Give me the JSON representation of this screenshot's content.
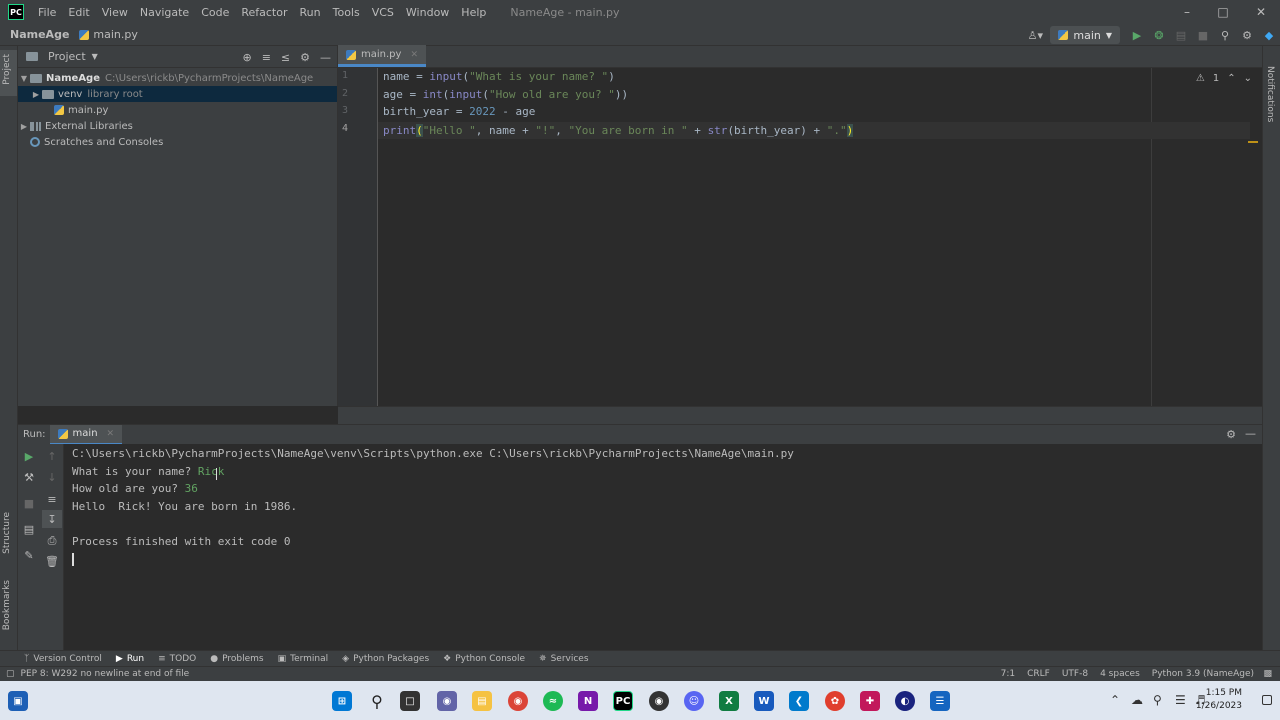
{
  "titlebar": {
    "logo": "PC",
    "menu": [
      "File",
      "Edit",
      "View",
      "Navigate",
      "Code",
      "Refactor",
      "Run",
      "Tools",
      "VCS",
      "Window",
      "Help"
    ],
    "window_title": "NameAge - main.py",
    "controls": [
      "minimize-icon",
      "maximize-icon",
      "close-icon"
    ]
  },
  "navbar": {
    "project": "NameAge",
    "file": "main.py",
    "run_config": "main"
  },
  "project_panel": {
    "title": "Project",
    "tree": [
      {
        "label": "NameAge",
        "hint": "C:\\Users\\rickb\\PycharmProjects\\NameAge",
        "icon": "folder-icon"
      },
      {
        "label": "venv",
        "hint": "library root",
        "icon": "folder-icon"
      },
      {
        "label": "main.py",
        "hint": "",
        "icon": "python-file-icon"
      },
      {
        "label": "External Libraries",
        "hint": "",
        "icon": "library-icon"
      },
      {
        "label": "Scratches and Consoles",
        "hint": "",
        "icon": "scratches-icon"
      }
    ]
  },
  "editor": {
    "tab": "main.py",
    "line_numbers": [
      "1",
      "2",
      "3",
      "4"
    ],
    "lines": [
      [
        "name = ",
        "input",
        "(",
        "\"What is your name? \"",
        ")"
      ],
      [
        "age = ",
        "int",
        "(",
        "input",
        "(",
        "\"How old are you? \"",
        "))"
      ],
      [
        "birth_year = ",
        "2022",
        " - age"
      ],
      [
        "print",
        "(",
        "\"Hello \"",
        ", name + ",
        "\"!\"",
        ", ",
        "\"You are born in \"",
        " + ",
        "str",
        "(birth_year) + ",
        "\".\"",
        ")"
      ]
    ],
    "inspection": "1"
  },
  "run_panel": {
    "label": "Run:",
    "tab": "main",
    "console": {
      "command": "C:\\Users\\rickb\\PycharmProjects\\NameAge\\venv\\Scripts\\python.exe C:\\Users\\rickb\\PycharmProjects\\NameAge\\main.py",
      "prompt1": "What is your name? ",
      "input1": "Rick",
      "prompt2": "How old are you? ",
      "input2": "36",
      "output": "Hello  Rick! You are born in 1986.",
      "exit": "Process finished with exit code 0"
    }
  },
  "side_labels": {
    "project": "Project",
    "structure": "Structure",
    "bookmarks": "Bookmarks",
    "notifications": "Notifications"
  },
  "tool_windows": [
    "Version Control",
    "Run",
    "TODO",
    "Problems",
    "Terminal",
    "Python Packages",
    "Python Console",
    "Services"
  ],
  "statusbar": {
    "message": "PEP 8: W292 no newline at end of file",
    "position": "7:1",
    "line_sep": "CRLF",
    "encoding": "UTF-8",
    "indent": "4 spaces",
    "interpreter": "Python 3.9 (NameAge)"
  },
  "taskbar": {
    "time": "1:15 PM",
    "date": "1/26/2023"
  },
  "colors": {
    "keyword_fn": "#8888c6",
    "string": "#6a8759",
    "number": "#6897bb",
    "input_text": "#62a362",
    "accent": "#4a88c7"
  }
}
